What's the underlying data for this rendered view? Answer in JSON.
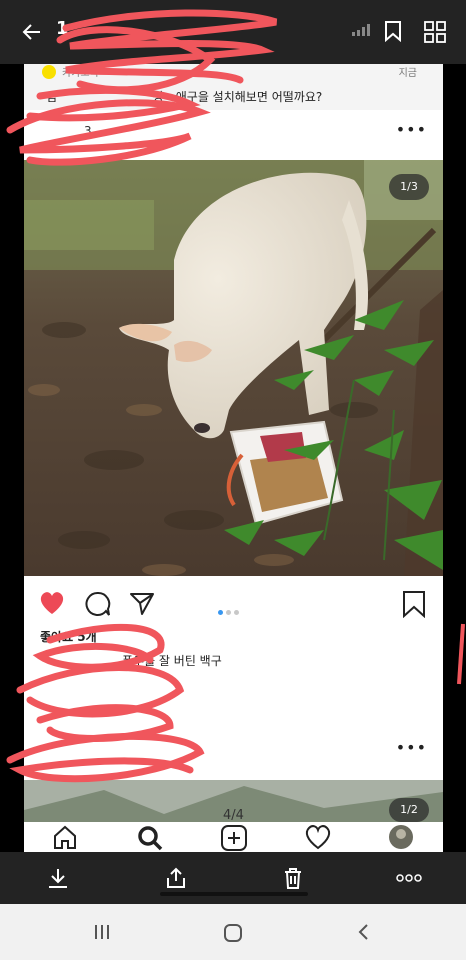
{
  "viewer": {
    "title": "1",
    "page_indicator": "4/4"
  },
  "notification": {
    "app_name": "카카오톡",
    "time": "지금",
    "message_start": "김",
    "message_end": "장\u0000애구을 설치해보면 어떨까요?"
  },
  "post": {
    "author_partial": "3",
    "image_counter": "1/3",
    "carousel_total": 3,
    "carousel_active": 1,
    "likes_label": "좋아요 5개",
    "caption": "폭우를 잘 버틴 백구",
    "next_image_counter": "1/2"
  },
  "icons": {
    "back": "back-arrow-icon",
    "bookmark_top": "bookmark-icon",
    "grid": "grid-icon",
    "heart": "heart-icon",
    "comment": "comment-icon",
    "share": "share-icon",
    "save": "bookmark-icon",
    "home": "home-icon",
    "search": "search-icon",
    "add": "add-icon",
    "activity": "heart-outline-icon",
    "profile": "avatar-icon",
    "download": "download-icon",
    "upload": "share-upload-icon",
    "delete": "trash-icon",
    "menu": "more-icon"
  },
  "colors": {
    "heart_active": "#ed4956",
    "carousel_active": "#3897f0",
    "scribble": "#f0565c"
  }
}
